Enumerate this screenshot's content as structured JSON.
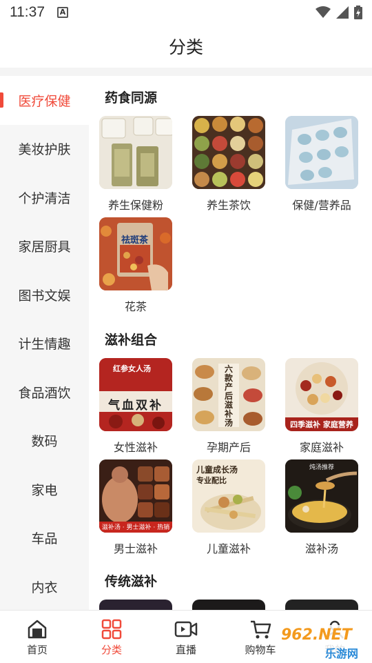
{
  "status": {
    "time": "11:37",
    "a_label": "A"
  },
  "header": {
    "title": "分类"
  },
  "sidebar": {
    "items": [
      {
        "label": "医疗保健",
        "active": true
      },
      {
        "label": "美妆护肤"
      },
      {
        "label": "个护清洁"
      },
      {
        "label": "家居厨具"
      },
      {
        "label": "图书文娱"
      },
      {
        "label": "计生情趣"
      },
      {
        "label": "食品酒饮"
      },
      {
        "label": "数码"
      },
      {
        "label": "家电"
      },
      {
        "label": "车品"
      },
      {
        "label": "内衣"
      }
    ]
  },
  "sections": [
    {
      "title": "药食同源",
      "items": [
        {
          "label": "养生保健粉",
          "text": ""
        },
        {
          "label": "养生茶饮",
          "text": ""
        },
        {
          "label": "保健/营养品",
          "text": ""
        },
        {
          "label": "花茶",
          "text": "祛斑茶"
        }
      ]
    },
    {
      "title": "滋补组合",
      "items": [
        {
          "label": "女性滋补",
          "text": "红参女人汤",
          "text2": "气血双补"
        },
        {
          "label": "孕期产后",
          "text": "六款产后滋补汤",
          "text2": ""
        },
        {
          "label": "家庭滋补",
          "text": "四季滋补  家庭营养",
          "text2": ""
        },
        {
          "label": "男士滋补",
          "text": "滋补汤 · 男士滋补 · 热销",
          "text2": ""
        },
        {
          "label": "儿童滋补",
          "text": "儿童成长汤",
          "text2": "专业配比"
        },
        {
          "label": "滋补汤",
          "text": "炖汤推荐",
          "text2": ""
        }
      ]
    },
    {
      "title": "传统滋补",
      "items": []
    }
  ],
  "tabs": [
    {
      "label": "首页",
      "icon": "home-icon"
    },
    {
      "label": "分类",
      "icon": "category-icon",
      "active": true
    },
    {
      "label": "直播",
      "icon": "live-icon"
    },
    {
      "label": "购物车",
      "icon": "cart-icon"
    },
    {
      "label": "我的",
      "icon": "profile-icon"
    }
  ],
  "watermark": {
    "line1": "962.NET",
    "line2": "乐游网"
  },
  "colors": {
    "accent": "#f04a3a",
    "sidebar_bg": "#f6f6f6"
  }
}
